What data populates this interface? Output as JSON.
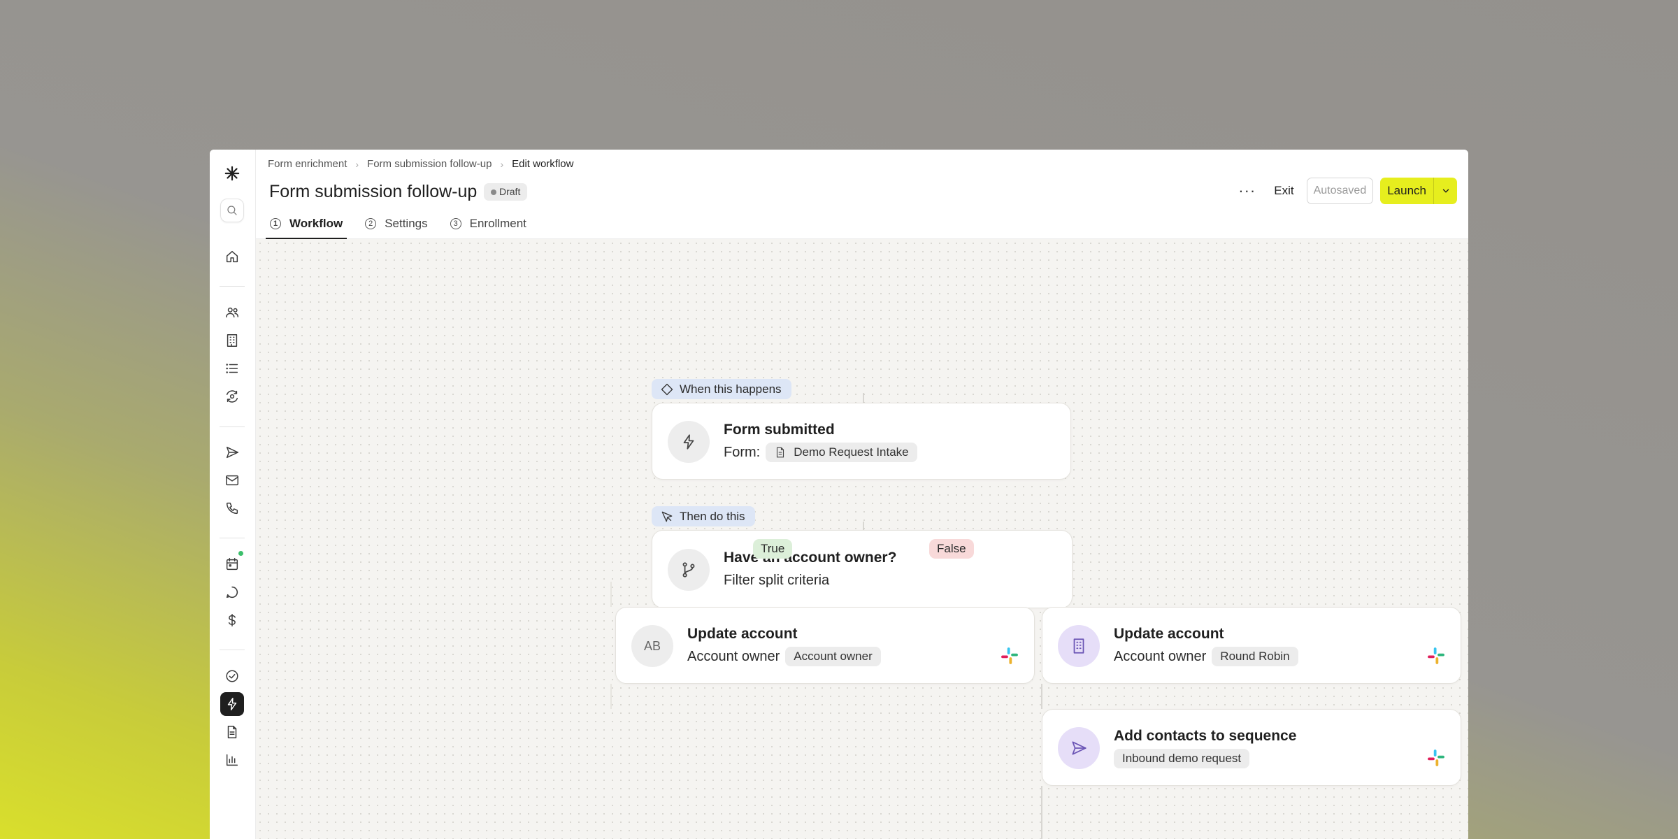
{
  "app": {
    "logo": "asterisk-logo-icon"
  },
  "breadcrumbs": [
    {
      "label": "Form enrichment"
    },
    {
      "label": "Form submission follow-up"
    },
    {
      "label": "Edit workflow"
    }
  ],
  "header": {
    "title": "Form submission follow-up",
    "status_badge": "Draft",
    "more_label": "···",
    "exit_label": "Exit",
    "autosaved_label": "Autosaved",
    "launch_label": "Launch"
  },
  "tabs": [
    {
      "num": "1",
      "label": "Workflow",
      "active": true
    },
    {
      "num": "2",
      "label": "Settings",
      "active": false
    },
    {
      "num": "3",
      "label": "Enrollment",
      "active": false
    }
  ],
  "sidebar": {
    "items": [
      "search-icon",
      "home-icon",
      "people-icon",
      "building-icon",
      "list-icon",
      "eye-sync-icon",
      "send-icon",
      "mail-icon",
      "phone-icon",
      "calendar-icon",
      "chat-icon",
      "dollar-icon",
      "check-circle-icon",
      "bolt-icon",
      "document-icon",
      "chart-icon"
    ],
    "active": "bolt-icon",
    "notification_color": "#3bbf6b"
  },
  "workflow": {
    "trigger_label": "When this happens",
    "trigger": {
      "title": "Form submitted",
      "sub_prefix": "Form:",
      "form_name": "Demo Request Intake"
    },
    "action_label": "Then do this",
    "filter": {
      "title": "Have an account owner?",
      "sub": "Filter split criteria"
    },
    "branch_true": "True",
    "branch_false": "False",
    "update_true": {
      "initials": "AB",
      "title": "Update account",
      "sub_prefix": "Account owner",
      "value": "Account owner"
    },
    "update_false": {
      "title": "Update account",
      "sub_prefix": "Account owner",
      "value": "Round Robin"
    },
    "sequence": {
      "title": "Add contacts to sequence",
      "value": "Inbound demo request"
    }
  },
  "colors": {
    "accent": "#e6ee1e",
    "trigger_chip": "#dde6f6",
    "true_branch": "#dcefd9",
    "false_branch": "#f8d9d9"
  }
}
